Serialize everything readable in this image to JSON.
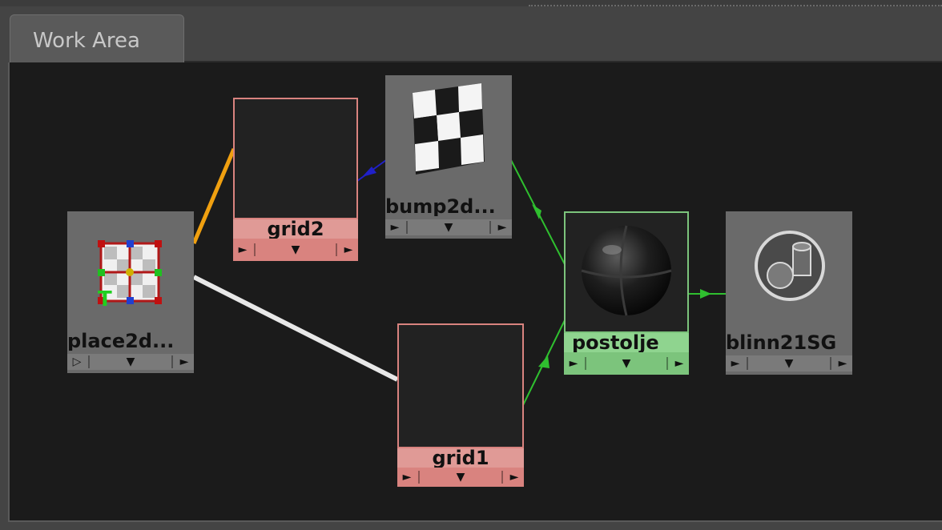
{
  "tab": {
    "label": "Work Area"
  },
  "nodes": [
    {
      "id": "place2d",
      "label": "place2d..."
    },
    {
      "id": "grid2",
      "label": "grid2"
    },
    {
      "id": "bump2d",
      "label": "bump2d..."
    },
    {
      "id": "grid1",
      "label": "grid1"
    },
    {
      "id": "postolje",
      "label": "postolje"
    },
    {
      "id": "blinn21SG",
      "label": "blinn21SG"
    }
  ],
  "glyphs": {
    "port_arrow": "►",
    "port_menu": "▼",
    "port_hollow": "▷"
  },
  "colors": {
    "background": "#1b1b1b",
    "texture_node": "#d9837f",
    "material_node": "#7cc47c",
    "utility_node": "#6a6a6a",
    "wire_uv": "#e8e8e8",
    "wire_orange": "#f0a010",
    "wire_blue": "#2020c8",
    "wire_green": "#2fbf2f"
  }
}
